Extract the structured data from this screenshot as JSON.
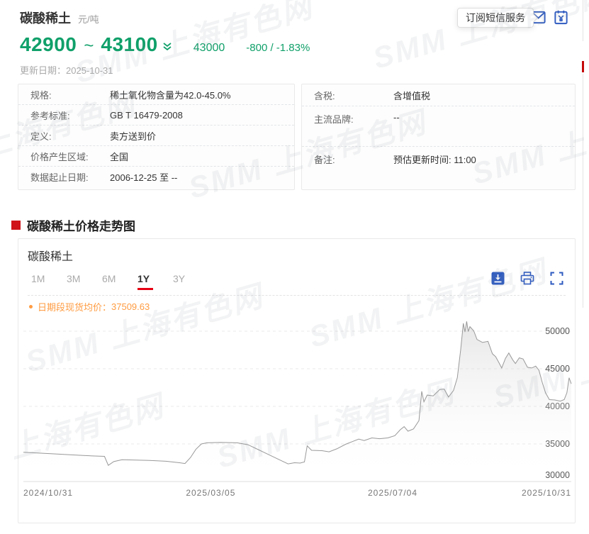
{
  "watermark": {
    "text": "SMM 上海有色网"
  },
  "colors": {
    "green": "#10a06a",
    "red_accent": "#e60012",
    "red_marker": "#cf1318",
    "blue_icon": "#2f5bc0",
    "orange": "#ff9c42",
    "line_gray": "#999999"
  },
  "header": {
    "title": "碳酸稀土",
    "unit": "元/吨",
    "price_low": "42900",
    "price_separator": "~",
    "price_high": "43100",
    "price_down_icon": "double-chevron-down",
    "avg_price": "43000",
    "change": "-800 / -1.83%",
    "update_label": "更新日期：",
    "update_value": "2025-10-31",
    "subscribe_button": "订阅短信服务",
    "icons": [
      "mail-icon",
      "invoice-icon"
    ]
  },
  "spec_left": {
    "rows": [
      {
        "label": "规格:",
        "value": "稀土氧化物含量为42.0-45.0%"
      },
      {
        "label": "参考标准:",
        "value": "GB T 16479-2008"
      },
      {
        "label": "定义:",
        "value": "卖方送到价"
      },
      {
        "label": "价格产生区域:",
        "value": "全国"
      },
      {
        "label": "数据起止日期:",
        "value": "2006-12-25 至 --"
      }
    ]
  },
  "spec_right": {
    "rows": [
      {
        "label": "含税:",
        "value": "含增值税"
      },
      {
        "label": "主流品牌:",
        "value": "--"
      },
      {
        "label": "备注:",
        "value": "预估更新时间: 11:00"
      }
    ]
  },
  "section": {
    "title": "碳酸稀土价格走势图"
  },
  "chart_card": {
    "title": "碳酸稀土",
    "tabs": [
      {
        "label": "1M",
        "active": false
      },
      {
        "label": "3M",
        "active": false
      },
      {
        "label": "6M",
        "active": false
      },
      {
        "label": "1Y",
        "active": true
      },
      {
        "label": "3Y",
        "active": false
      }
    ],
    "toolbar_icons": [
      "download-image-icon",
      "print-icon",
      "fullscreen-icon"
    ],
    "legend_label": "日期段现货均价：",
    "legend_value": "37509.63"
  },
  "chart_data": {
    "type": "area",
    "title": "碳酸稀土",
    "ylabel": "元/吨",
    "ylim": [
      30000,
      52500
    ],
    "y_ticks": [
      30000,
      35000,
      40000,
      45000,
      50000
    ],
    "grid": "dashed-horizontal",
    "legend_position": "top-left",
    "avg_value": 37509.63,
    "x_ticks": [
      {
        "f": 0,
        "label": "2024/10/31"
      },
      {
        "f": 0.342,
        "label": "2025/03/05"
      },
      {
        "f": 0.674,
        "label": "2025/07/04"
      },
      {
        "f": 1,
        "label": "2025/10/31"
      }
    ],
    "points": [
      [
        0,
        33900
      ],
      [
        0.05,
        33700
      ],
      [
        0.1,
        33500
      ],
      [
        0.13,
        33400
      ],
      [
        0.148,
        33350
      ],
      [
        0.155,
        32150
      ],
      [
        0.165,
        32650
      ],
      [
        0.18,
        32900
      ],
      [
        0.23,
        32800
      ],
      [
        0.26,
        32700
      ],
      [
        0.285,
        32500
      ],
      [
        0.295,
        32400
      ],
      [
        0.305,
        33200
      ],
      [
        0.315,
        34300
      ],
      [
        0.325,
        35000
      ],
      [
        0.335,
        35150
      ],
      [
        0.36,
        35200
      ],
      [
        0.39,
        35150
      ],
      [
        0.41,
        34900
      ],
      [
        0.43,
        34200
      ],
      [
        0.45,
        33500
      ],
      [
        0.47,
        32800
      ],
      [
        0.483,
        32350
      ],
      [
        0.495,
        32500
      ],
      [
        0.505,
        32450
      ],
      [
        0.513,
        32600
      ],
      [
        0.518,
        34750
      ],
      [
        0.526,
        34150
      ],
      [
        0.545,
        34100
      ],
      [
        0.558,
        33950
      ],
      [
        0.572,
        34350
      ],
      [
        0.588,
        34950
      ],
      [
        0.6,
        35300
      ],
      [
        0.612,
        35650
      ],
      [
        0.622,
        35450
      ],
      [
        0.636,
        35800
      ],
      [
        0.65,
        35700
      ],
      [
        0.665,
        35800
      ],
      [
        0.678,
        36100
      ],
      [
        0.688,
        36900
      ],
      [
        0.695,
        37300
      ],
      [
        0.702,
        36700
      ],
      [
        0.712,
        37000
      ],
      [
        0.722,
        38100
      ],
      [
        0.727,
        42000
      ],
      [
        0.731,
        40600
      ],
      [
        0.737,
        41500
      ],
      [
        0.748,
        41400
      ],
      [
        0.76,
        42250
      ],
      [
        0.768,
        42300
      ],
      [
        0.776,
        41250
      ],
      [
        0.785,
        42100
      ],
      [
        0.792,
        43800
      ],
      [
        0.798,
        47500
      ],
      [
        0.803,
        51050
      ],
      [
        0.806,
        49900
      ],
      [
        0.809,
        51300
      ],
      [
        0.812,
        49950
      ],
      [
        0.815,
        50600
      ],
      [
        0.822,
        50050
      ],
      [
        0.828,
        48900
      ],
      [
        0.838,
        48500
      ],
      [
        0.848,
        48650
      ],
      [
        0.856,
        47000
      ],
      [
        0.862,
        46600
      ],
      [
        0.868,
        45800
      ],
      [
        0.873,
        45100
      ],
      [
        0.88,
        46400
      ],
      [
        0.886,
        47100
      ],
      [
        0.893,
        46200
      ],
      [
        0.898,
        45700
      ],
      [
        0.905,
        46450
      ],
      [
        0.912,
        46300
      ],
      [
        0.92,
        45200
      ],
      [
        0.928,
        45100
      ],
      [
        0.935,
        45350
      ],
      [
        0.941,
        44800
      ],
      [
        0.947,
        43200
      ],
      [
        0.953,
        41800
      ],
      [
        0.96,
        40900
      ],
      [
        0.97,
        40850
      ],
      [
        0.98,
        40700
      ],
      [
        0.987,
        40900
      ],
      [
        0.992,
        41800
      ],
      [
        0.996,
        43800
      ],
      [
        1,
        43000
      ]
    ]
  }
}
